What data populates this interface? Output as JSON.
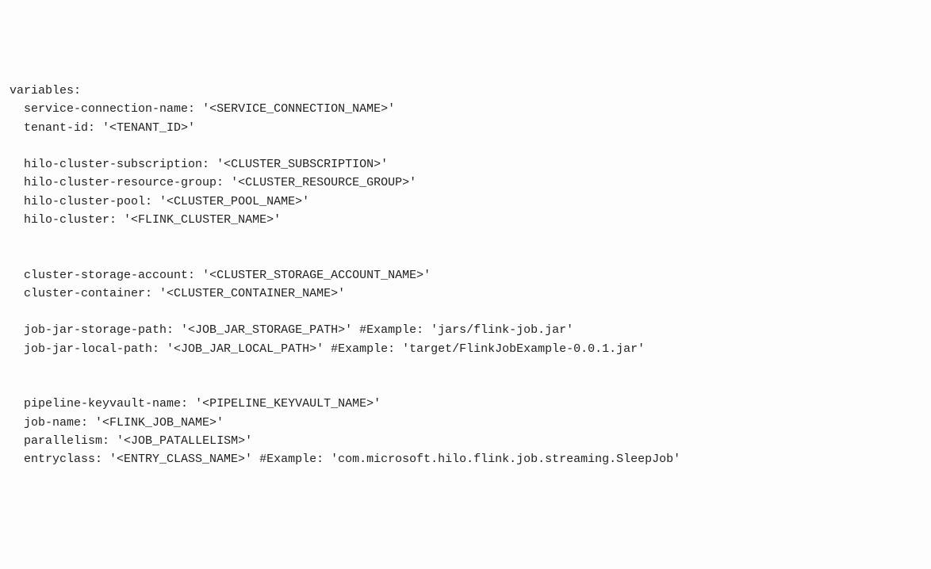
{
  "header": "variables:",
  "rows": [
    {
      "type": "kv",
      "key": "service-connection-name",
      "val": "'<SERVICE_CONNECTION_NAME>'",
      "comment": ""
    },
    {
      "type": "kv",
      "key": "tenant-id",
      "val": "'<TENANT_ID>'",
      "comment": ""
    },
    {
      "type": "blank"
    },
    {
      "type": "kv",
      "key": "hilo-cluster-subscription",
      "val": "'<CLUSTER_SUBSCRIPTION>'",
      "comment": ""
    },
    {
      "type": "kv",
      "key": "hilo-cluster-resource-group",
      "val": "'<CLUSTER_RESOURCE_GROUP>'",
      "comment": ""
    },
    {
      "type": "kv",
      "key": "hilo-cluster-pool",
      "val": "'<CLUSTER_POOL_NAME>'",
      "comment": ""
    },
    {
      "type": "kv",
      "key": "hilo-cluster",
      "val": "'<FLINK_CLUSTER_NAME>'",
      "comment": ""
    },
    {
      "type": "blank"
    },
    {
      "type": "blank"
    },
    {
      "type": "kv",
      "key": "cluster-storage-account",
      "val": "'<CLUSTER_STORAGE_ACCOUNT_NAME>'",
      "comment": ""
    },
    {
      "type": "kv",
      "key": "cluster-container",
      "val": "'<CLUSTER_CONTAINER_NAME>'",
      "comment": ""
    },
    {
      "type": "blank"
    },
    {
      "type": "kv",
      "key": "job-jar-storage-path",
      "val": "'<JOB_JAR_STORAGE_PATH>'",
      "comment": " #Example: 'jars/flink-job.jar'"
    },
    {
      "type": "kv",
      "key": "job-jar-local-path",
      "val": "'<JOB_JAR_LOCAL_PATH>'",
      "comment": " #Example: 'target/FlinkJobExample-0.0.1.jar'"
    },
    {
      "type": "blank"
    },
    {
      "type": "blank"
    },
    {
      "type": "kv",
      "key": "pipeline-keyvault-name",
      "val": "'<PIPELINE_KEYVAULT_NAME>'",
      "comment": ""
    },
    {
      "type": "kv",
      "key": "job-name",
      "val": "'<FLINK_JOB_NAME>'",
      "comment": ""
    },
    {
      "type": "kv",
      "key": "parallelism",
      "val": "'<JOB_PATALLELISM>'",
      "comment": ""
    },
    {
      "type": "kv",
      "key": "entryclass",
      "val": "'<ENTRY_CLASS_NAME>'",
      "comment": " #Example: 'com.microsoft.hilo.flink.job.streaming.SleepJob'"
    }
  ]
}
